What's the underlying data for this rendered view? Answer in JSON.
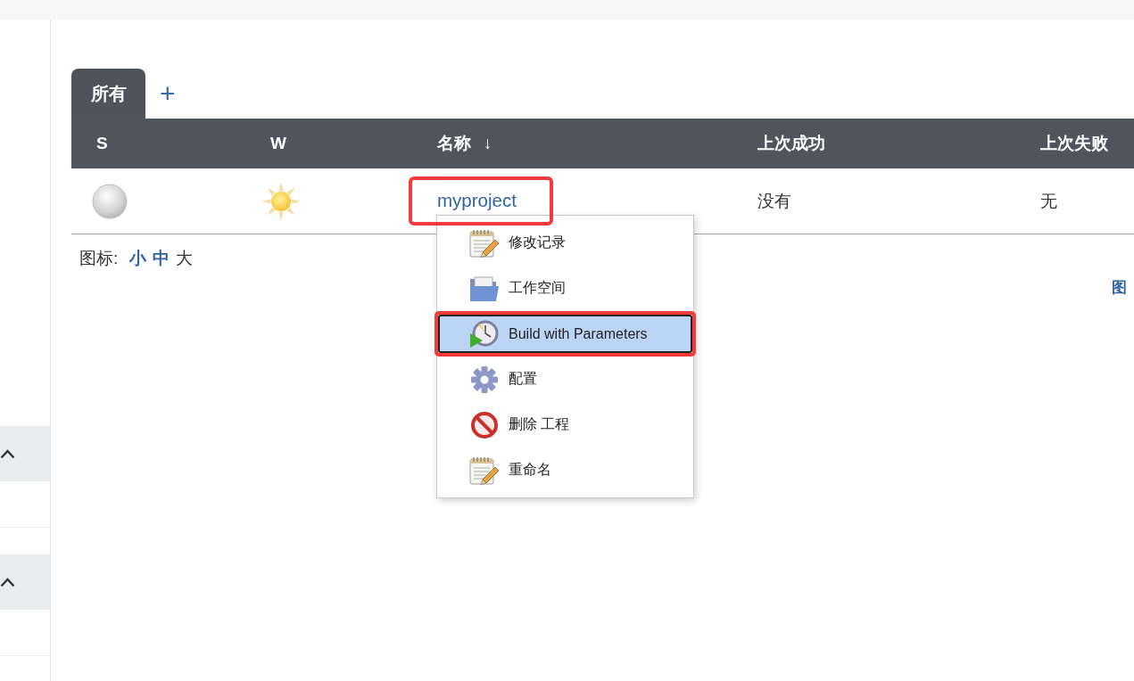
{
  "sidebar": {
    "panels": [
      {
        "expanded": true
      },
      {
        "expanded": true
      }
    ]
  },
  "tabs": [
    {
      "label": "所有",
      "selected": true
    }
  ],
  "add_tab": "+",
  "table": {
    "columns": [
      {
        "label": "S"
      },
      {
        "label": "W"
      },
      {
        "label": "名称",
        "sort": "↓"
      },
      {
        "label": "上次成功"
      },
      {
        "label": "上次失败"
      }
    ],
    "rows": [
      {
        "name": "myproject",
        "highlighted": true,
        "last_success": "没有",
        "last_failure": "无"
      }
    ]
  },
  "context_menu": {
    "items": [
      {
        "kind": "changes",
        "label": "修改记录",
        "selected": false,
        "highlighted": false
      },
      {
        "kind": "workspace",
        "label": "工作空间",
        "selected": false,
        "highlighted": false
      },
      {
        "kind": "build",
        "label": "Build with Parameters",
        "selected": true,
        "highlighted": true
      },
      {
        "kind": "configure",
        "label": "配置",
        "selected": false,
        "highlighted": false
      },
      {
        "kind": "delete",
        "label": "删除 工程",
        "selected": false,
        "highlighted": false
      },
      {
        "kind": "rename",
        "label": "重命名",
        "selected": false,
        "highlighted": false
      }
    ]
  },
  "icon_size": {
    "label": "图标:",
    "options": [
      {
        "label": "小",
        "selected": false
      },
      {
        "label": "中",
        "selected": false
      },
      {
        "label": "大",
        "selected": true
      }
    ]
  },
  "legend_link": "图"
}
